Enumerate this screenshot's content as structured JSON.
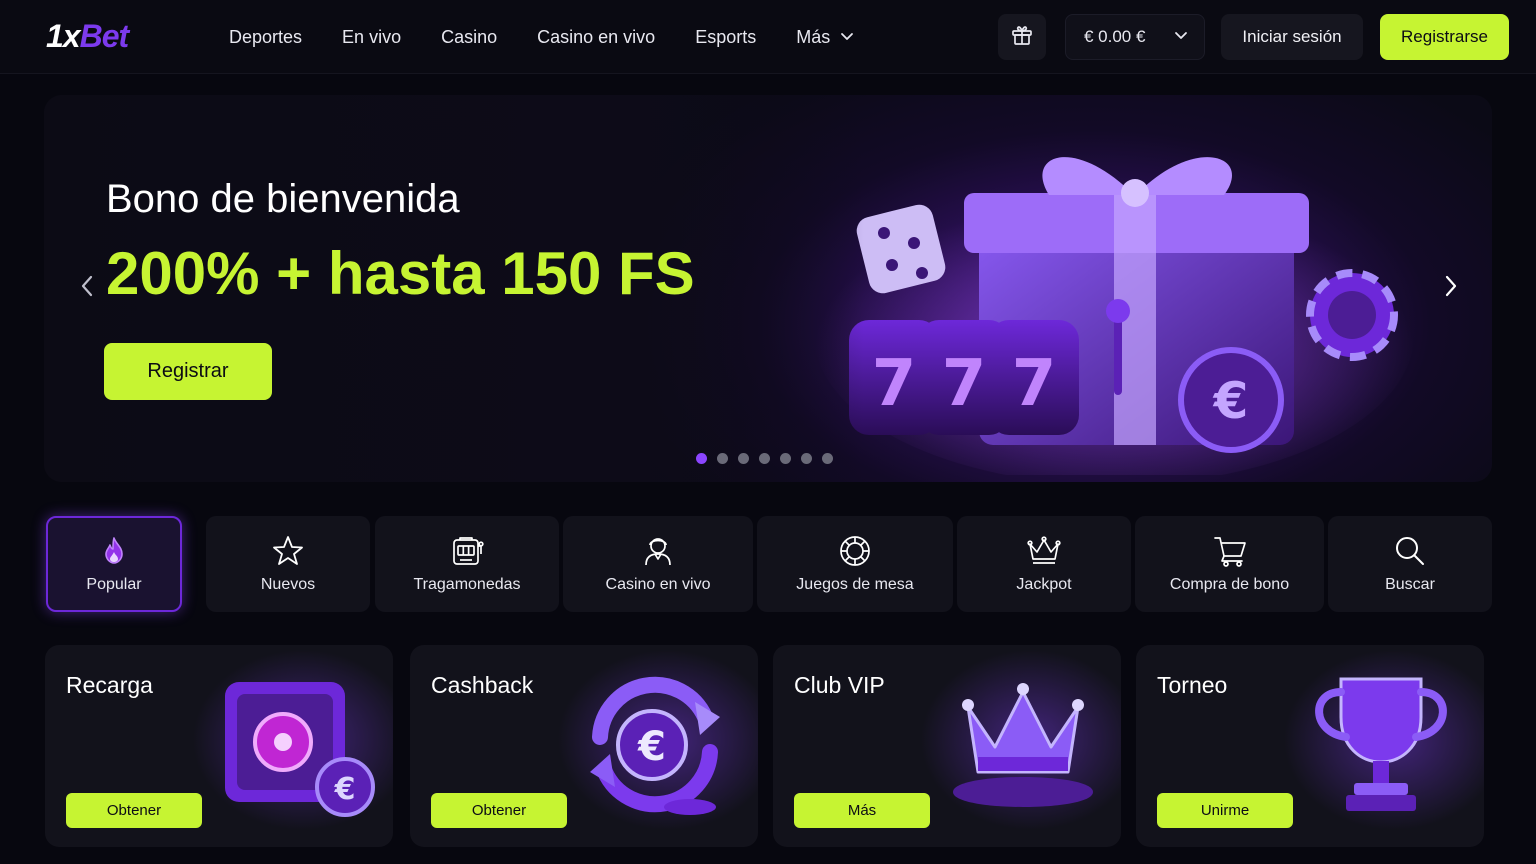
{
  "header": {
    "logo": {
      "part1": "1x",
      "part2": "Bet"
    },
    "nav": [
      {
        "label": "Deportes"
      },
      {
        "label": "En vivo"
      },
      {
        "label": "Casino"
      },
      {
        "label": "Casino en vivo"
      },
      {
        "label": "Esports"
      },
      {
        "label": "Más"
      }
    ],
    "balance": "€ 0.00 €",
    "login_label": "Iniciar sesión",
    "register_label": "Registrarse"
  },
  "hero": {
    "title": "Bono de bienvenida",
    "subtitle": "200% + hasta 150 FS",
    "cta_label": "Registrar",
    "slide_count": 7,
    "active_slide": 1
  },
  "categories": [
    {
      "label": "Popular",
      "icon": "flame-icon",
      "active": true
    },
    {
      "label": "Nuevos",
      "icon": "star-icon"
    },
    {
      "label": "Tragamonedas",
      "icon": "slot-machine-icon"
    },
    {
      "label": "Casino en vivo",
      "icon": "dealer-icon"
    },
    {
      "label": "Juegos de mesa",
      "icon": "poker-chip-icon"
    },
    {
      "label": "Jackpot",
      "icon": "crown-icon"
    },
    {
      "label": "Compra de bono",
      "icon": "cart-icon"
    },
    {
      "label": "Buscar",
      "icon": "search-icon"
    }
  ],
  "promos": [
    {
      "title": "Recarga",
      "button": "Obtener",
      "art": "safe-icon"
    },
    {
      "title": "Cashback",
      "button": "Obtener",
      "art": "cashback-icon"
    },
    {
      "title": "Club VIP",
      "button": "Más",
      "art": "crown-icon"
    },
    {
      "title": "Torneo",
      "button": "Unirme",
      "art": "trophy-icon"
    }
  ],
  "colors": {
    "accent": "#c6f432",
    "purple": "#7c3aed",
    "background": "#07070f",
    "card": "#12121b"
  }
}
